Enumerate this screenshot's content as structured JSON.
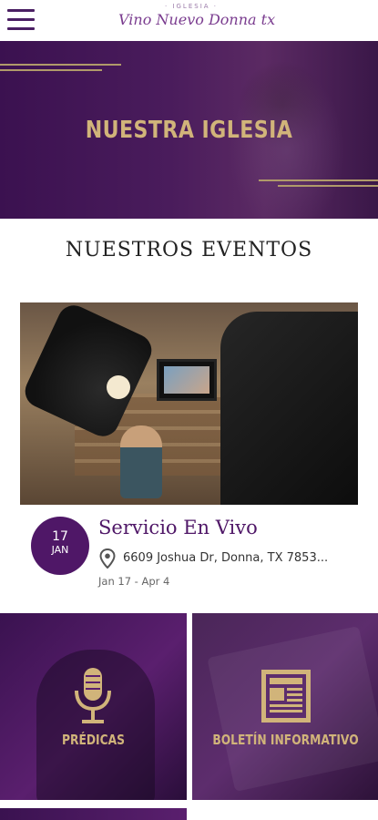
{
  "header": {
    "logo_top": "· IGLESIA ·",
    "logo_main": "Vino Nuevo Donna tx",
    "menu_icon": "hamburger-menu-icon"
  },
  "hero": {
    "title": "NUESTRA IGLESIA",
    "accent_color": "#d1b47a"
  },
  "events_section": {
    "title": "NUESTROS EVENTOS",
    "event": {
      "day": "17",
      "month": "JAN",
      "title": "Servicio En Vivo",
      "address": "6609 Joshua Dr, Donna, TX 7853...",
      "dates": "Jan 17 - Apr 4",
      "badge_color": "#4f1767"
    }
  },
  "tiles": [
    {
      "label": "PRÉDICAS",
      "icon": "microphone-icon"
    },
    {
      "label": "BOLETÍN INFORMATIVO",
      "icon": "newspaper-icon"
    }
  ]
}
